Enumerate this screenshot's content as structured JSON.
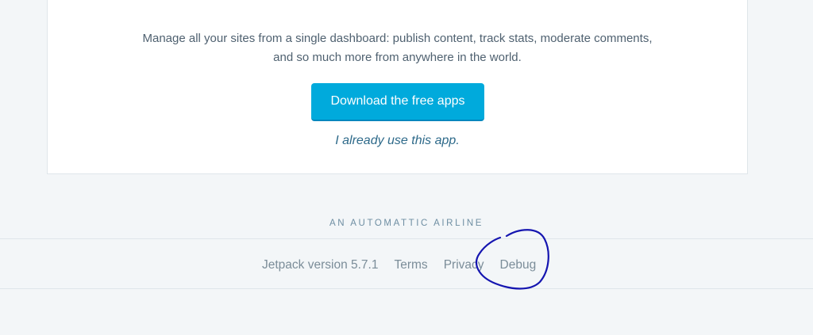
{
  "card": {
    "description_line1": "Manage all your sites from a single dashboard: publish content, track stats, moderate comments,",
    "description_line2": "and so much more from anywhere in the world.",
    "download_label": "Download the free apps",
    "already_link": "I already use this app."
  },
  "footer": {
    "tagline": "AN AUTOMATTIC AIRLINE",
    "version": "Jetpack version 5.7.1",
    "terms": "Terms",
    "privacy": "Privacy",
    "debug": "Debug"
  },
  "colors": {
    "page_bg": "#f3f6f8",
    "button_bg": "#00aadc",
    "annotation": "#1515b0"
  }
}
